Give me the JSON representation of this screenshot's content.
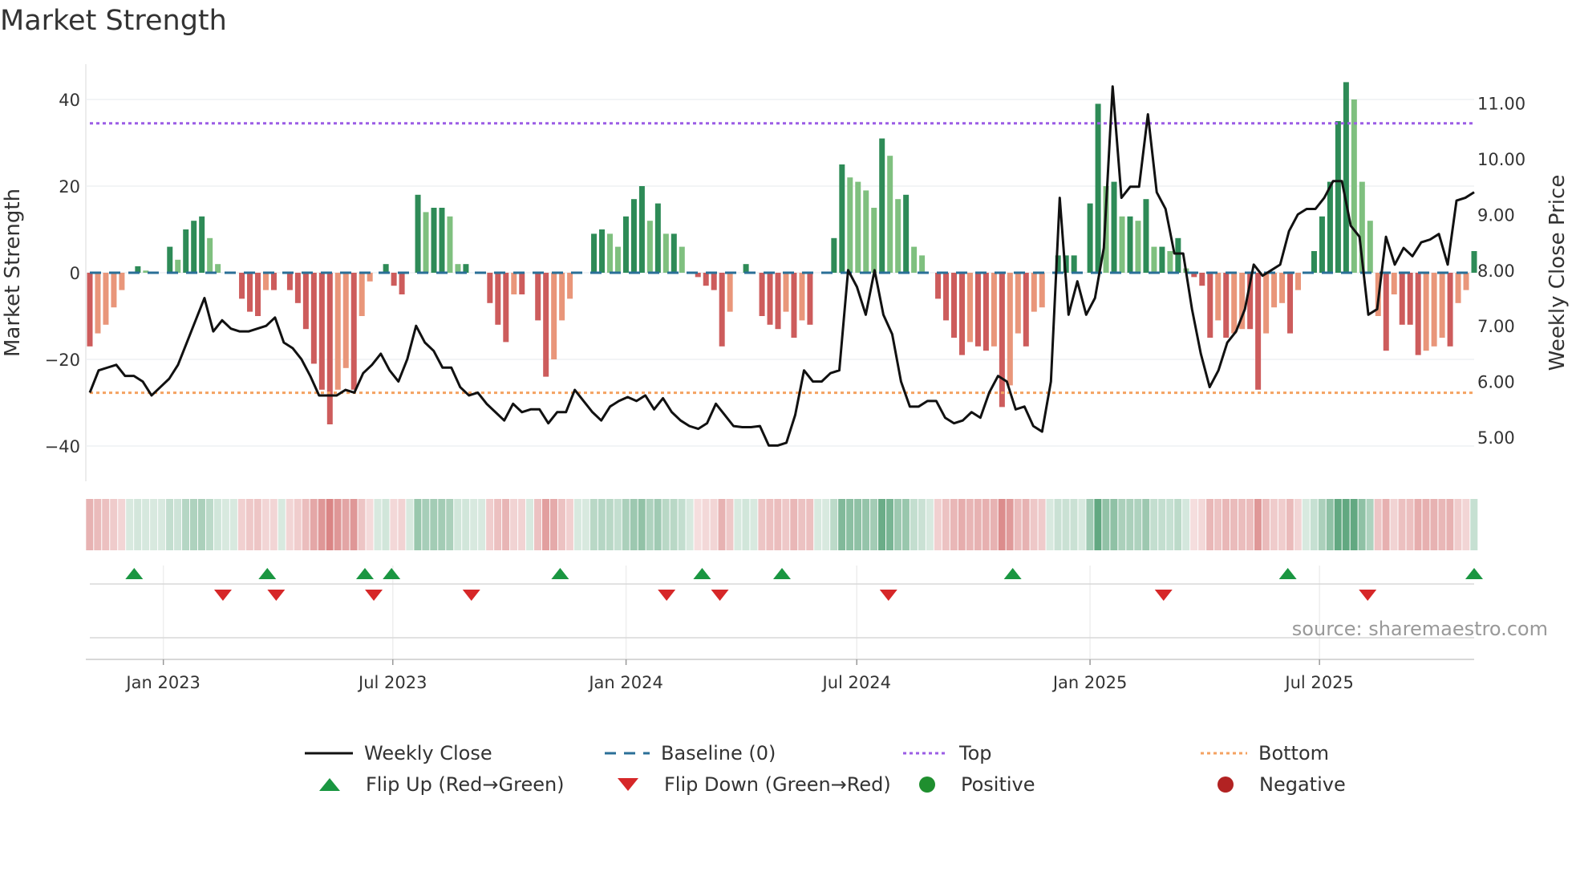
{
  "title": "Market Strength",
  "source": "source: sharemaestro.com",
  "chart_data": {
    "type": "bar+line",
    "title": "Market Strength",
    "ylabel": "Market Strength",
    "y2label": "Weekly Close Price",
    "ylim": [
      -48,
      48
    ],
    "y2lim": [
      4.4,
      11.7
    ],
    "yticks": [
      40,
      20,
      0,
      -20,
      -40
    ],
    "ytick_labels": [
      "40",
      "20",
      "0",
      "−20",
      "−40"
    ],
    "y2ticks": [
      11,
      10,
      9,
      8,
      7,
      6,
      5
    ],
    "y2tick_labels": [
      "11.00",
      "10.00",
      "9.00",
      "8.00",
      "7.00",
      "6.00",
      "5.00"
    ],
    "xlim": [
      "2022-11-04",
      "2025-10-31"
    ],
    "xticks": [
      "2023-01-01",
      "2023-07-01",
      "2024-01-01",
      "2024-07-01",
      "2025-01-01",
      "2025-07-01"
    ],
    "xtick_labels": [
      "Jan 2023",
      "Jul 2023",
      "Jan 2024",
      "Jul 2024",
      "Jan 2025",
      "Jul 2025"
    ],
    "top_level": 34.5,
    "bottom_level": -27.7,
    "baseline": 0,
    "strength": [
      -17,
      -14,
      -12,
      -8,
      -4,
      0,
      1.5,
      0.5,
      0,
      0,
      6,
      3,
      10,
      12,
      13,
      8,
      2,
      0,
      0,
      -6,
      -9,
      -10,
      -4,
      -4,
      0,
      -4,
      -7,
      -13,
      -21,
      -27,
      -35,
      -27,
      -22,
      -27,
      -10,
      -2,
      0,
      2,
      -3,
      -5,
      0,
      18,
      14,
      15,
      15,
      13,
      2,
      2,
      0,
      0,
      -7,
      -12,
      -16,
      -5,
      -5,
      0,
      -11,
      -24,
      -20,
      -11,
      -6,
      0,
      0,
      9,
      10,
      9,
      6,
      13,
      17,
      20,
      12,
      16,
      9,
      9,
      6,
      0,
      -1,
      -3,
      -4,
      -17,
      -9,
      0,
      2,
      0,
      -10,
      -12,
      -13,
      -9,
      -15,
      -11,
      -12,
      0,
      0,
      8,
      25,
      22,
      21,
      19,
      15,
      31,
      27,
      17,
      18,
      6,
      4,
      0,
      -6,
      -11,
      -15,
      -19,
      -16,
      -17,
      -18,
      -17,
      -31,
      -26,
      -14,
      -17,
      -9,
      -8,
      0,
      4,
      4,
      4,
      0,
      16,
      39,
      20,
      21,
      13,
      13,
      12,
      17,
      6,
      6,
      5,
      8,
      1,
      -1,
      -3,
      -15,
      -11,
      -15,
      -14,
      -13,
      -13,
      -27,
      -14,
      -8,
      -7,
      -14,
      -4,
      0,
      5,
      13,
      21,
      35,
      44,
      40,
      21,
      12,
      -10,
      -18,
      -5,
      -12,
      -12,
      -19,
      -18,
      -17,
      -15,
      -17,
      -7,
      -4,
      5
    ],
    "weekly_close": [
      5.8,
      6.2,
      6.25,
      6.3,
      6.1,
      6.1,
      6.0,
      5.75,
      5.9,
      6.05,
      6.3,
      6.7,
      7.1,
      7.5,
      6.9,
      7.1,
      6.95,
      6.9,
      6.9,
      6.95,
      7.0,
      7.15,
      6.7,
      6.6,
      6.4,
      6.1,
      5.75,
      5.75,
      5.75,
      5.85,
      5.8,
      6.15,
      6.3,
      6.5,
      6.2,
      6.0,
      6.4,
      7.0,
      6.7,
      6.55,
      6.25,
      6.25,
      5.9,
      5.75,
      5.8,
      5.6,
      5.45,
      5.3,
      5.6,
      5.45,
      5.5,
      5.5,
      5.25,
      5.45,
      5.45,
      5.85,
      5.65,
      5.45,
      5.3,
      5.55,
      5.65,
      5.72,
      5.65,
      5.75,
      5.5,
      5.7,
      5.45,
      5.3,
      5.2,
      5.15,
      5.25,
      5.6,
      5.4,
      5.2,
      5.18,
      5.18,
      5.2,
      4.85,
      4.85,
      4.9,
      5.4,
      6.2,
      6.0,
      6.0,
      6.15,
      6.2,
      8.0,
      7.7,
      7.2,
      8.0,
      7.2,
      6.85,
      6.0,
      5.55,
      5.55,
      5.65,
      5.65,
      5.35,
      5.25,
      5.3,
      5.45,
      5.35,
      5.8,
      6.1,
      6.0,
      5.5,
      5.55,
      5.2,
      5.1,
      6.0,
      9.3,
      7.2,
      7.8,
      7.2,
      7.5,
      8.4,
      11.3,
      9.3,
      9.5,
      9.5,
      10.8,
      9.4,
      9.1,
      8.3,
      8.3,
      7.3,
      6.5,
      5.9,
      6.2,
      6.7,
      6.9,
      7.3,
      8.1,
      7.9,
      8.0,
      8.1,
      8.7,
      9.0,
      9.1,
      9.1,
      9.3,
      9.6,
      9.6,
      8.8,
      8.6,
      7.2,
      7.3,
      8.6,
      8.1,
      8.4,
      8.25,
      8.5,
      8.55,
      8.65,
      8.1,
      9.25,
      9.3,
      9.4
    ],
    "flip_up_dates": [
      "2022-12-09",
      "2023-03-24",
      "2023-06-09",
      "2023-06-30",
      "2023-11-10",
      "2024-03-01",
      "2024-05-03",
      "2024-11-01",
      "2025-06-06",
      "2025-10-31"
    ],
    "flip_down_dates": [
      "2023-02-17",
      "2023-03-31",
      "2023-06-16",
      "2023-09-01",
      "2024-02-02",
      "2024-03-15",
      "2024-07-26",
      "2025-02-28",
      "2025-08-08"
    ],
    "colors": {
      "pos_strong": "#2e8b57",
      "pos_weak": "#7fc07f",
      "neg_strong": "#cd5c5c",
      "neg_weak": "#e9967a",
      "line": "#111111",
      "baseline": "#2a6f97",
      "top": "#9b5de5",
      "bottom": "#f4a261",
      "flip_up": "#1a9641",
      "flip_down": "#d62728",
      "positive": "#1f8f2f",
      "negative": "#b22222"
    },
    "legend": [
      {
        "label": "Weekly Close",
        "kind": "line"
      },
      {
        "label": "Baseline (0)",
        "kind": "dash"
      },
      {
        "label": "Top",
        "kind": "dot-purple"
      },
      {
        "label": "Bottom",
        "kind": "dot-orange"
      },
      {
        "label": "Flip Up (Red→Green)",
        "kind": "tri-up"
      },
      {
        "label": "Flip Down (Green→Red)",
        "kind": "tri-down"
      },
      {
        "label": "Positive",
        "kind": "circle-green"
      },
      {
        "label": "Negative",
        "kind": "circle-red"
      }
    ],
    "legend_position": "bottom"
  }
}
